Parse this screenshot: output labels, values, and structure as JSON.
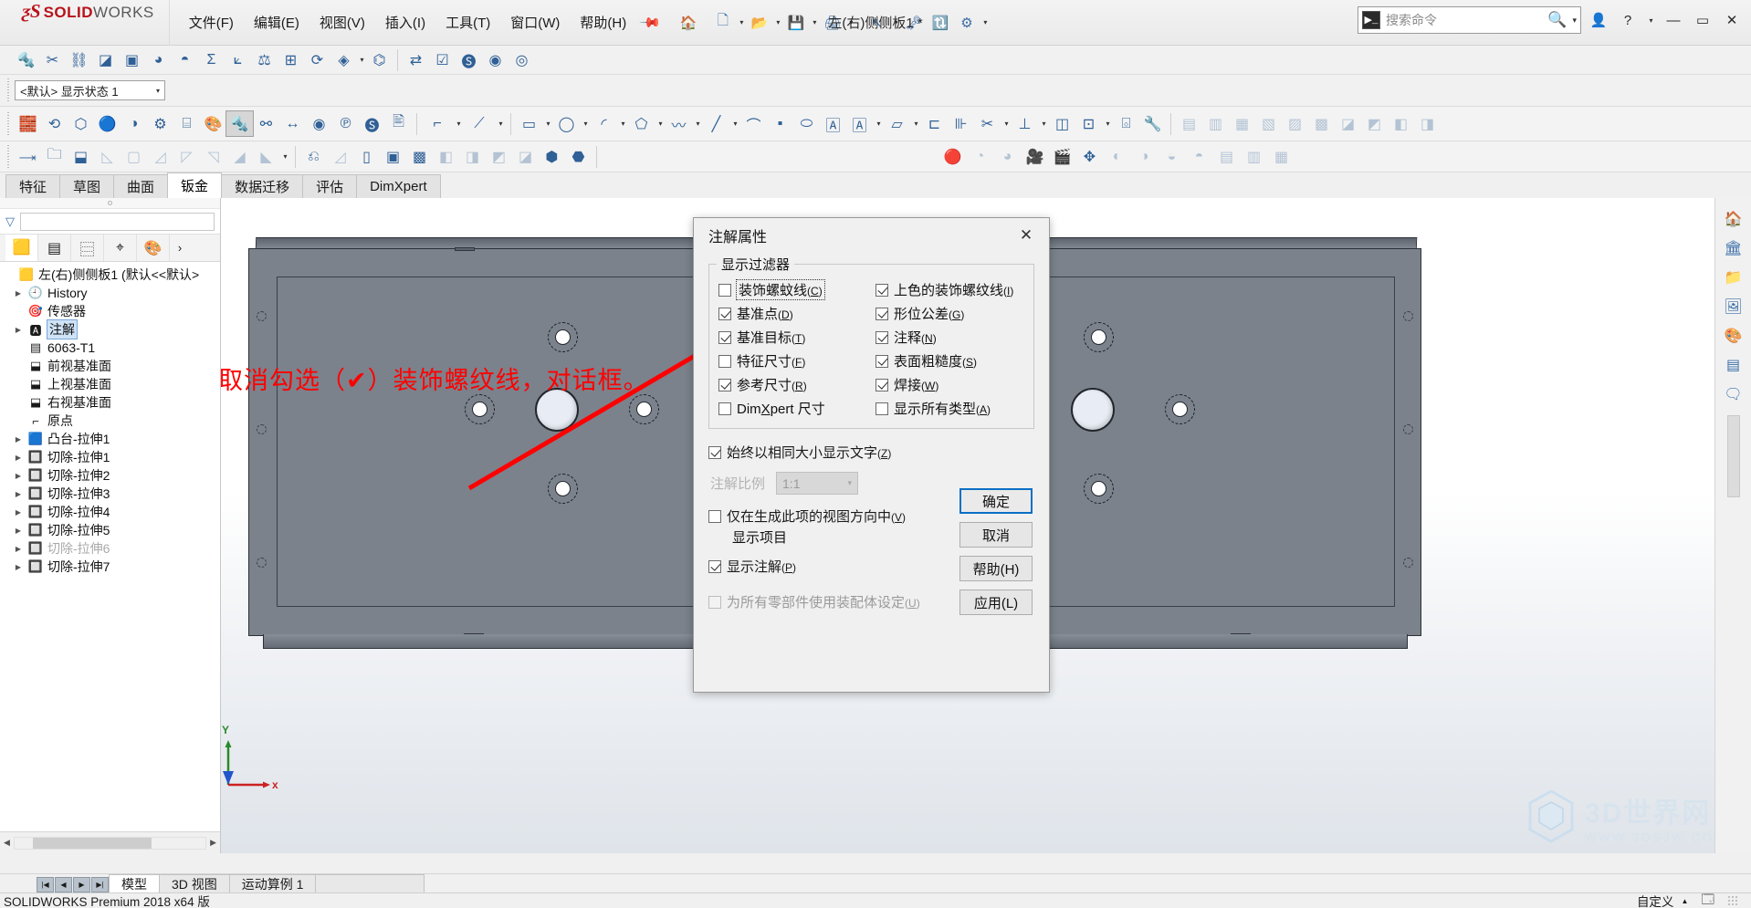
{
  "app": {
    "brand_ds": "ƺS",
    "brand_solid": "SOLID",
    "brand_works": "WORKS",
    "document_title": "左(右)侧侧板1 *",
    "status_text": "SOLIDWORKS Premium 2018 x64 版",
    "customize_label": "自定义"
  },
  "menu": [
    {
      "label": "文件(F)"
    },
    {
      "label": "编辑(E)"
    },
    {
      "label": "视图(V)"
    },
    {
      "label": "插入(I)"
    },
    {
      "label": "工具(T)"
    },
    {
      "label": "窗口(W)"
    },
    {
      "label": "帮助(H)"
    }
  ],
  "search": {
    "placeholder": "搜索命令"
  },
  "window_buttons": {
    "account": "\u0000",
    "help": "?",
    "minimize": "—",
    "maximize": "▭",
    "close": "✕"
  },
  "display_state": {
    "value": "<默认> 显示状态 1"
  },
  "ribbon_tabs": [
    {
      "label": "特征",
      "active": false
    },
    {
      "label": "草图",
      "active": false
    },
    {
      "label": "曲面",
      "active": false
    },
    {
      "label": "钣金",
      "active": true
    },
    {
      "label": "数据迁移",
      "active": false
    },
    {
      "label": "评估",
      "active": false
    },
    {
      "label": "DimXpert",
      "active": false
    }
  ],
  "left_panel": {
    "tabs": [
      {
        "name": "feature-manager-tab",
        "icon": "part-icon",
        "active": true
      },
      {
        "name": "property-manager-tab",
        "icon": "list-icon",
        "active": false
      },
      {
        "name": "configuration-manager-tab",
        "icon": "config-icon",
        "active": false
      },
      {
        "name": "dimxpert-manager-tab",
        "icon": "target-icon",
        "active": false
      },
      {
        "name": "display-manager-tab",
        "icon": "appearance-icon",
        "active": false
      },
      {
        "name": "more-tabs",
        "icon": "chevron-right-icon",
        "active": false
      }
    ],
    "tree": [
      {
        "label": "左(右)侧侧板1  (默认<<默认>",
        "icon": "part-icon",
        "expandable": false,
        "level": 0,
        "dim": false,
        "selected": false
      },
      {
        "label": "History",
        "icon": "history-icon",
        "expandable": true,
        "level": 1,
        "dim": false,
        "selected": false
      },
      {
        "label": "传感器",
        "icon": "sensor-icon",
        "expandable": false,
        "level": 1,
        "dim": false,
        "selected": false
      },
      {
        "label": "注解",
        "icon": "annotation-icon",
        "expandable": true,
        "level": 1,
        "dim": false,
        "selected": true
      },
      {
        "label": "6063-T1",
        "icon": "material-icon",
        "expandable": false,
        "level": 1,
        "dim": false,
        "selected": false
      },
      {
        "label": "前视基准面",
        "icon": "plane-icon",
        "expandable": false,
        "level": 1,
        "dim": false,
        "selected": false
      },
      {
        "label": "上视基准面",
        "icon": "plane-icon",
        "expandable": false,
        "level": 1,
        "dim": false,
        "selected": false
      },
      {
        "label": "右视基准面",
        "icon": "plane-icon",
        "expandable": false,
        "level": 1,
        "dim": false,
        "selected": false
      },
      {
        "label": "原点",
        "icon": "origin-icon",
        "expandable": false,
        "level": 1,
        "dim": false,
        "selected": false
      },
      {
        "label": "凸台-拉伸1",
        "icon": "boss-extrude-icon",
        "expandable": true,
        "level": 1,
        "dim": false,
        "selected": false
      },
      {
        "label": "切除-拉伸1",
        "icon": "cut-extrude-icon",
        "expandable": true,
        "level": 1,
        "dim": false,
        "selected": false
      },
      {
        "label": "切除-拉伸2",
        "icon": "cut-extrude-icon",
        "expandable": true,
        "level": 1,
        "dim": false,
        "selected": false
      },
      {
        "label": "切除-拉伸3",
        "icon": "cut-extrude-icon",
        "expandable": true,
        "level": 1,
        "dim": false,
        "selected": false
      },
      {
        "label": "切除-拉伸4",
        "icon": "cut-extrude-icon",
        "expandable": true,
        "level": 1,
        "dim": false,
        "selected": false
      },
      {
        "label": "切除-拉伸5",
        "icon": "cut-extrude-icon",
        "expandable": true,
        "level": 1,
        "dim": false,
        "selected": false
      },
      {
        "label": "切除-拉伸6",
        "icon": "cut-extrude-icon",
        "expandable": true,
        "level": 1,
        "dim": true,
        "selected": false
      },
      {
        "label": "切除-拉伸7",
        "icon": "cut-extrude-icon",
        "expandable": true,
        "level": 1,
        "dim": false,
        "selected": false
      }
    ]
  },
  "dialog": {
    "title": "注解属性",
    "close_label": "✕",
    "group_title": "显示过滤器",
    "checkboxes_left": [
      {
        "label": "装饰螺蚊线",
        "accel": "C",
        "checked": false,
        "disabled": false,
        "focused": true
      },
      {
        "label": "基准点",
        "accel": "D",
        "checked": true,
        "disabled": false,
        "focused": false
      },
      {
        "label": "基准目标",
        "accel": "T",
        "checked": true,
        "disabled": false,
        "focused": false
      },
      {
        "label": "特征尺寸",
        "accel": "F",
        "checked": false,
        "disabled": false,
        "focused": false
      },
      {
        "label": "参考尺寸",
        "accel": "R",
        "checked": true,
        "disabled": false,
        "focused": false
      },
      {
        "label": "DimXpert 尺寸",
        "accel": "X",
        "checked": false,
        "disabled": false,
        "focused": false
      }
    ],
    "checkboxes_right": [
      {
        "label": "上色的装饰螺纹线",
        "accel": "I",
        "checked": true,
        "disabled": false,
        "focused": false
      },
      {
        "label": "形位公差",
        "accel": "G",
        "checked": true,
        "disabled": false,
        "focused": false
      },
      {
        "label": "注释",
        "accel": "N",
        "checked": true,
        "disabled": false,
        "focused": false
      },
      {
        "label": "表面粗糙度",
        "accel": "S",
        "checked": true,
        "disabled": false,
        "focused": false
      },
      {
        "label": "焊接",
        "accel": "W",
        "checked": true,
        "disabled": false,
        "focused": false
      },
      {
        "label": "显示所有类型",
        "accel": "A",
        "checked": false,
        "disabled": false,
        "focused": false
      }
    ],
    "same_size_text": {
      "label": "始终以相同大小显示文字",
      "accel": "Z",
      "checked": true
    },
    "scale_label": "注解比例",
    "scale_value": "1:1",
    "only_in_view": {
      "label": "仅在生成此项的视图方向中",
      "accel": "V",
      "checked": false
    },
    "only_in_view_line2": "显示项目",
    "show_annotations": {
      "label": "显示注解",
      "accel": "P",
      "checked": true
    },
    "assembly_setting": {
      "label": "为所有零部件使用装配体设定",
      "accel": "U",
      "checked": false,
      "disabled": true
    },
    "buttons": [
      {
        "label": "确定",
        "primary": true
      },
      {
        "label": "取消",
        "primary": false
      },
      {
        "label": "帮助(H)",
        "primary": false
      },
      {
        "label": "应用(L)",
        "primary": false
      }
    ]
  },
  "annotation": {
    "text": "取消勾选（✔）装饰螺纹线，对话框。",
    "color": "#ff0000"
  },
  "triad": {
    "x_label": "x",
    "y_label": "Y"
  },
  "watermark": {
    "line1": "3D世界网",
    "line2": "WWW.3DSJW.COM"
  },
  "bottom_tabs": [
    {
      "label": "模型",
      "active": true
    },
    {
      "label": "3D 视图",
      "active": false
    },
    {
      "label": "运动算例 1",
      "active": false
    }
  ],
  "nav_buttons": [
    "|◀",
    "◀",
    "▶",
    "▶|"
  ]
}
